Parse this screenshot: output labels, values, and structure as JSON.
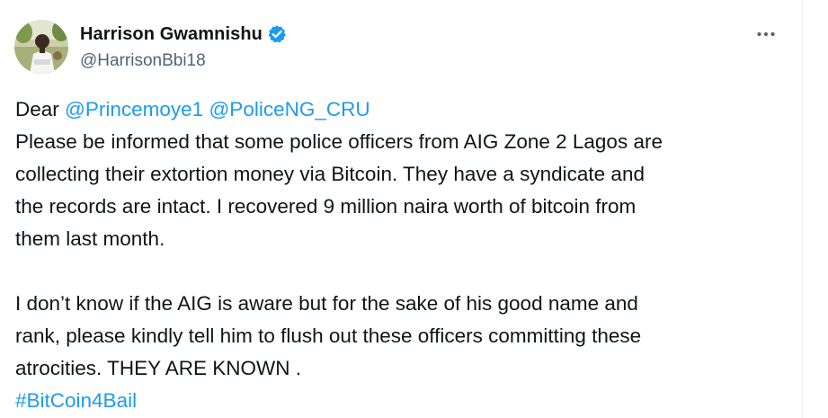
{
  "author": {
    "display_name": "Harrison Gwamnishu",
    "handle": "@HarrisonBbi18",
    "verified": true
  },
  "icons": {
    "verified": "verified-badge-icon",
    "more": "more-options-icon",
    "avatar": "profile-avatar"
  },
  "colors": {
    "link": "#1d9bf0",
    "text": "#0f1419",
    "muted": "#536471",
    "badge": "#1d9bf0"
  },
  "tweet": {
    "greeting": "Dear",
    "mention_1": "@Princemoye1",
    "mention_2": "@PoliceNG_CRU",
    "paragraph_1_lines": [
      "Please be informed that some police officers from AIG Zone 2 Lagos are",
      "collecting their extortion money via Bitcoin. They have a syndicate and",
      "the records are intact. I recovered 9 million naira worth of bitcoin from",
      "them last month."
    ],
    "paragraph_2_lines": [
      "I don’t know if the AIG is aware but for the sake of his good name and",
      "rank, please kindly tell him to flush out these officers committing these",
      "atrocities. THEY ARE KNOWN ."
    ],
    "hashtag": "#BitCoin4Bail"
  }
}
